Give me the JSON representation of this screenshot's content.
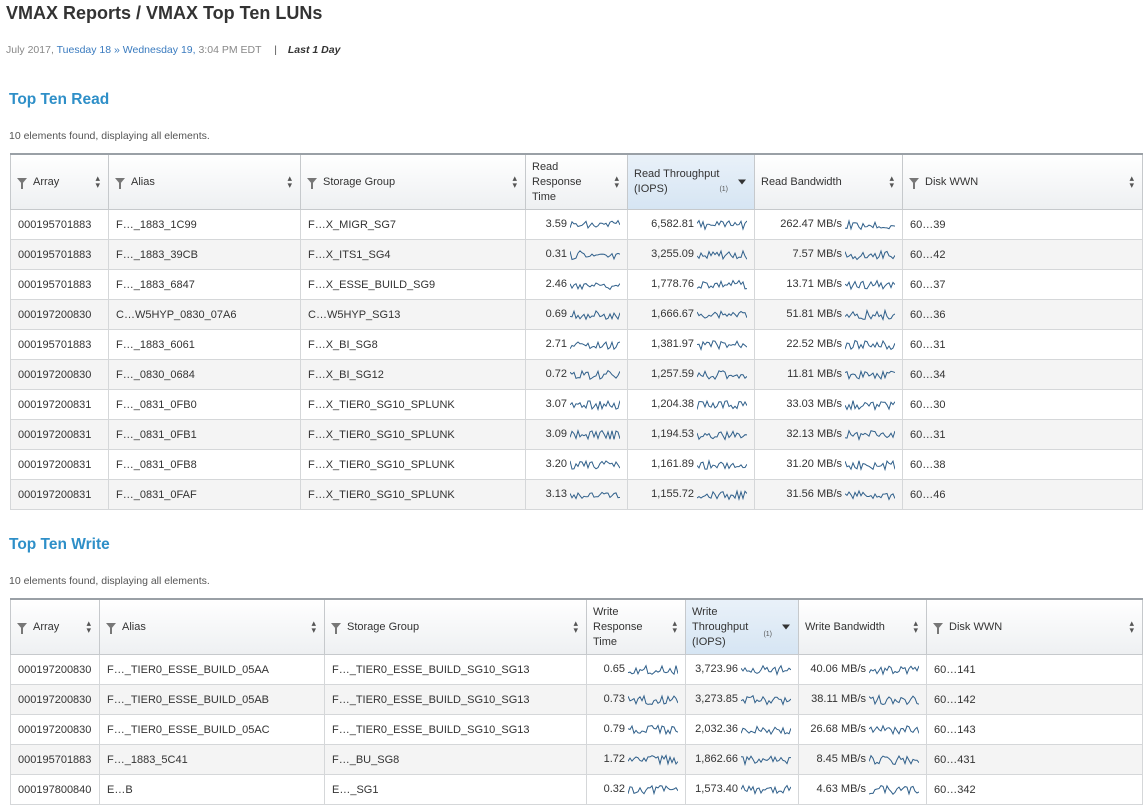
{
  "page": {
    "title": "VMAX Reports / VMAX Top Ten LUNs",
    "date_prefix": "July 2017,",
    "date_link": "Tuesday 18 » Wednesday 19,",
    "date_time": "3:04 PM EDT",
    "range": "Last 1 Day"
  },
  "read": {
    "title": "Top Ten Read",
    "count": "10 elements found, displaying all elements.",
    "headers": {
      "array": "Array",
      "alias": "Alias",
      "sg": "Storage Group",
      "resp": "Read Response Time",
      "tput": "Read Throughput (IOPS)",
      "tput_note": "(1)",
      "bw": "Read Bandwidth",
      "wwn": "Disk WWN"
    },
    "rows": [
      {
        "array": "000195701883",
        "alias": "F…_1883_1C99",
        "sg": "F…X_MIGR_SG7",
        "resp": "3.59",
        "tput": "6,582.81",
        "bw": "262.47 MB/s",
        "wwn": "60…39"
      },
      {
        "array": "000195701883",
        "alias": "F…_1883_39CB",
        "sg": "F…X_ITS1_SG4",
        "resp": "0.31",
        "tput": "3,255.09",
        "bw": "7.57 MB/s",
        "wwn": "60…42"
      },
      {
        "array": "000195701883",
        "alias": "F…_1883_6847",
        "sg": "F…X_ESSE_BUILD_SG9",
        "resp": "2.46",
        "tput": "1,778.76",
        "bw": "13.71 MB/s",
        "wwn": "60…37"
      },
      {
        "array": "000197200830",
        "alias": "C…W5HYP_0830_07A6",
        "sg": "C…W5HYP_SG13",
        "resp": "0.69",
        "tput": "1,666.67",
        "bw": "51.81 MB/s",
        "wwn": "60…36"
      },
      {
        "array": "000195701883",
        "alias": "F…_1883_6061",
        "sg": "F…X_BI_SG8",
        "resp": "2.71",
        "tput": "1,381.97",
        "bw": "22.52 MB/s",
        "wwn": "60…31"
      },
      {
        "array": "000197200830",
        "alias": "F…_0830_0684",
        "sg": "F…X_BI_SG12",
        "resp": "0.72",
        "tput": "1,257.59",
        "bw": "11.81 MB/s",
        "wwn": "60…34"
      },
      {
        "array": "000197200831",
        "alias": "F…_0831_0FB0",
        "sg": "F…X_TIER0_SG10_SPLUNK",
        "resp": "3.07",
        "tput": "1,204.38",
        "bw": "33.03 MB/s",
        "wwn": "60…30"
      },
      {
        "array": "000197200831",
        "alias": "F…_0831_0FB1",
        "sg": "F…X_TIER0_SG10_SPLUNK",
        "resp": "3.09",
        "tput": "1,194.53",
        "bw": "32.13 MB/s",
        "wwn": "60…31"
      },
      {
        "array": "000197200831",
        "alias": "F…_0831_0FB8",
        "sg": "F…X_TIER0_SG10_SPLUNK",
        "resp": "3.20",
        "tput": "1,161.89",
        "bw": "31.20 MB/s",
        "wwn": "60…38"
      },
      {
        "array": "000197200831",
        "alias": "F…_0831_0FAF",
        "sg": "F…X_TIER0_SG10_SPLUNK",
        "resp": "3.13",
        "tput": "1,155.72",
        "bw": "31.56 MB/s",
        "wwn": "60…46"
      }
    ]
  },
  "write": {
    "title": "Top Ten Write",
    "count": "10 elements found, displaying all elements.",
    "headers": {
      "array": "Array",
      "alias": "Alias",
      "sg": "Storage Group",
      "resp": "Write Response Time",
      "tput": "Write Throughput (IOPS)",
      "tput_note": "(1)",
      "bw": "Write Bandwidth",
      "wwn": "Disk WWN"
    },
    "rows": [
      {
        "array": "000197200830",
        "alias": "F…_TIER0_ESSE_BUILD_05AA",
        "sg": "F…_TIER0_ESSE_BUILD_SG10_SG13",
        "resp": "0.65",
        "tput": "3,723.96",
        "bw": "40.06 MB/s",
        "wwn": "60…141"
      },
      {
        "array": "000197200830",
        "alias": "F…_TIER0_ESSE_BUILD_05AB",
        "sg": "F…_TIER0_ESSE_BUILD_SG10_SG13",
        "resp": "0.73",
        "tput": "3,273.85",
        "bw": "38.11 MB/s",
        "wwn": "60…142"
      },
      {
        "array": "000197200830",
        "alias": "F…_TIER0_ESSE_BUILD_05AC",
        "sg": "F…_TIER0_ESSE_BUILD_SG10_SG13",
        "resp": "0.79",
        "tput": "2,032.36",
        "bw": "26.68 MB/s",
        "wwn": "60…143"
      },
      {
        "array": "000195701883",
        "alias": "F…_1883_5C41",
        "sg": "F…_BU_SG8",
        "resp": "1.72",
        "tput": "1,862.66",
        "bw": "8.45 MB/s",
        "wwn": "60…431"
      },
      {
        "array": "000197800840",
        "alias": "E…B",
        "sg": "E…_SG1",
        "resp": "0.32",
        "tput": "1,573.40",
        "bw": "4.63 MB/s",
        "wwn": "60…342"
      }
    ]
  }
}
